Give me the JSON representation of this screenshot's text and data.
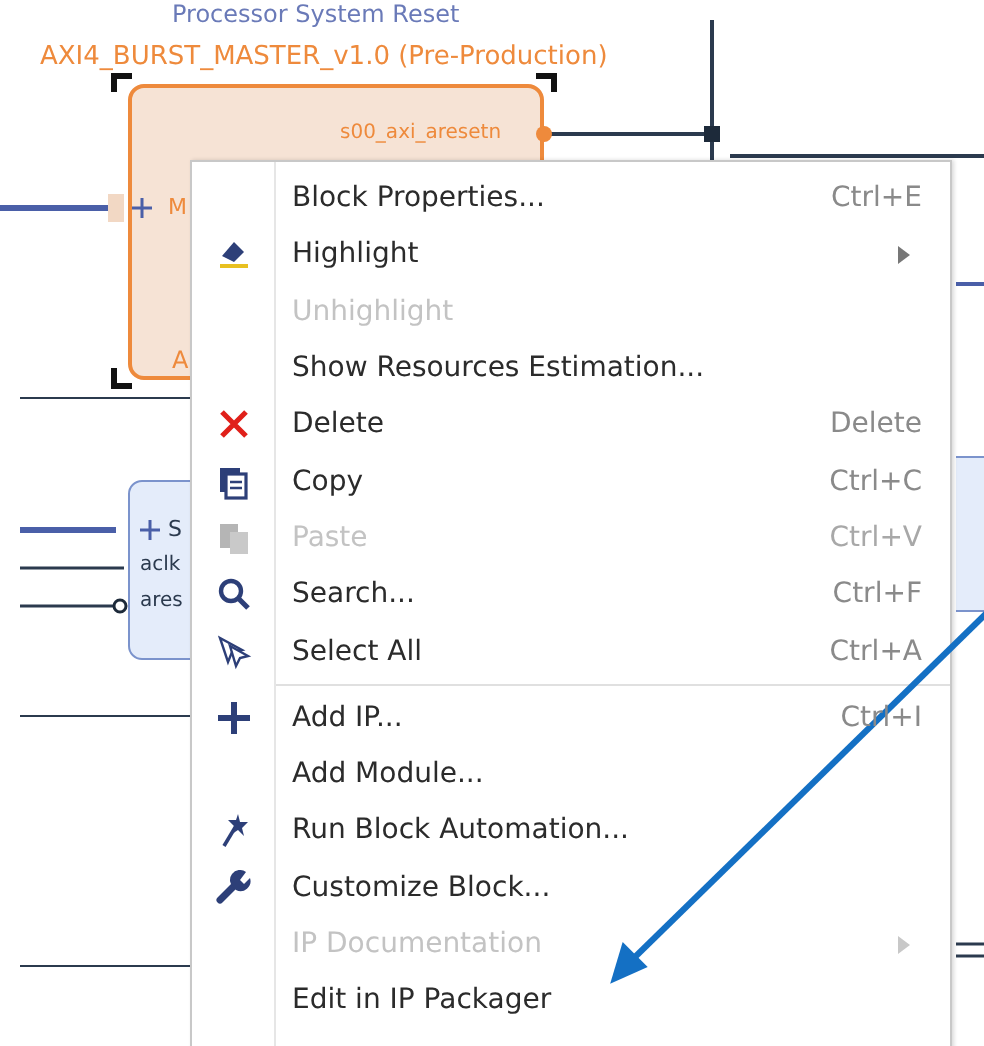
{
  "canvas": {
    "header": "Processor System Reset",
    "block": {
      "title": "AXI4_BURST_MASTER_v1.0 (Pre-Production)",
      "port_right": "s00_axi_aresetn",
      "port_left": "M",
      "footer": "A"
    },
    "block_2": {
      "port": "S",
      "pins": [
        "aclk",
        "ares"
      ]
    }
  },
  "context_menu": {
    "items": [
      {
        "kind": "item",
        "label": "Block Properties...",
        "shortcut": "Ctrl+E",
        "disabled": false,
        "submenu": false
      },
      {
        "kind": "item",
        "label": "Highlight",
        "disabled": false,
        "submenu": true
      },
      {
        "kind": "item",
        "label": "Unhighlight",
        "disabled": true,
        "submenu": false
      },
      {
        "kind": "item",
        "label": "Show Resources Estimation...",
        "disabled": false,
        "submenu": false
      },
      {
        "kind": "item",
        "label": "Delete",
        "shortcut": "Delete",
        "disabled": false,
        "submenu": false
      },
      {
        "kind": "item",
        "label": "Copy",
        "shortcut": "Ctrl+C",
        "disabled": false,
        "submenu": false
      },
      {
        "kind": "item",
        "label": "Paste",
        "shortcut": "Ctrl+V",
        "disabled": true,
        "submenu": false
      },
      {
        "kind": "item",
        "label": "Search...",
        "shortcut": "Ctrl+F",
        "disabled": false,
        "submenu": false
      },
      {
        "kind": "item",
        "label": "Select All",
        "shortcut": "Ctrl+A",
        "disabled": false,
        "submenu": false
      },
      {
        "kind": "separator"
      },
      {
        "kind": "item",
        "label": "Add IP...",
        "shortcut": "Ctrl+I",
        "disabled": false,
        "submenu": false
      },
      {
        "kind": "item",
        "label": "Add Module...",
        "disabled": false,
        "submenu": false
      },
      {
        "kind": "item",
        "label": "Run Block Automation...",
        "disabled": false,
        "submenu": false
      },
      {
        "kind": "item",
        "label": "Customize Block...",
        "disabled": false,
        "submenu": false
      },
      {
        "kind": "item",
        "label": "IP Documentation",
        "disabled": true,
        "submenu": true
      },
      {
        "kind": "item",
        "label": "Edit in IP Packager",
        "disabled": false,
        "submenu": false
      }
    ]
  }
}
